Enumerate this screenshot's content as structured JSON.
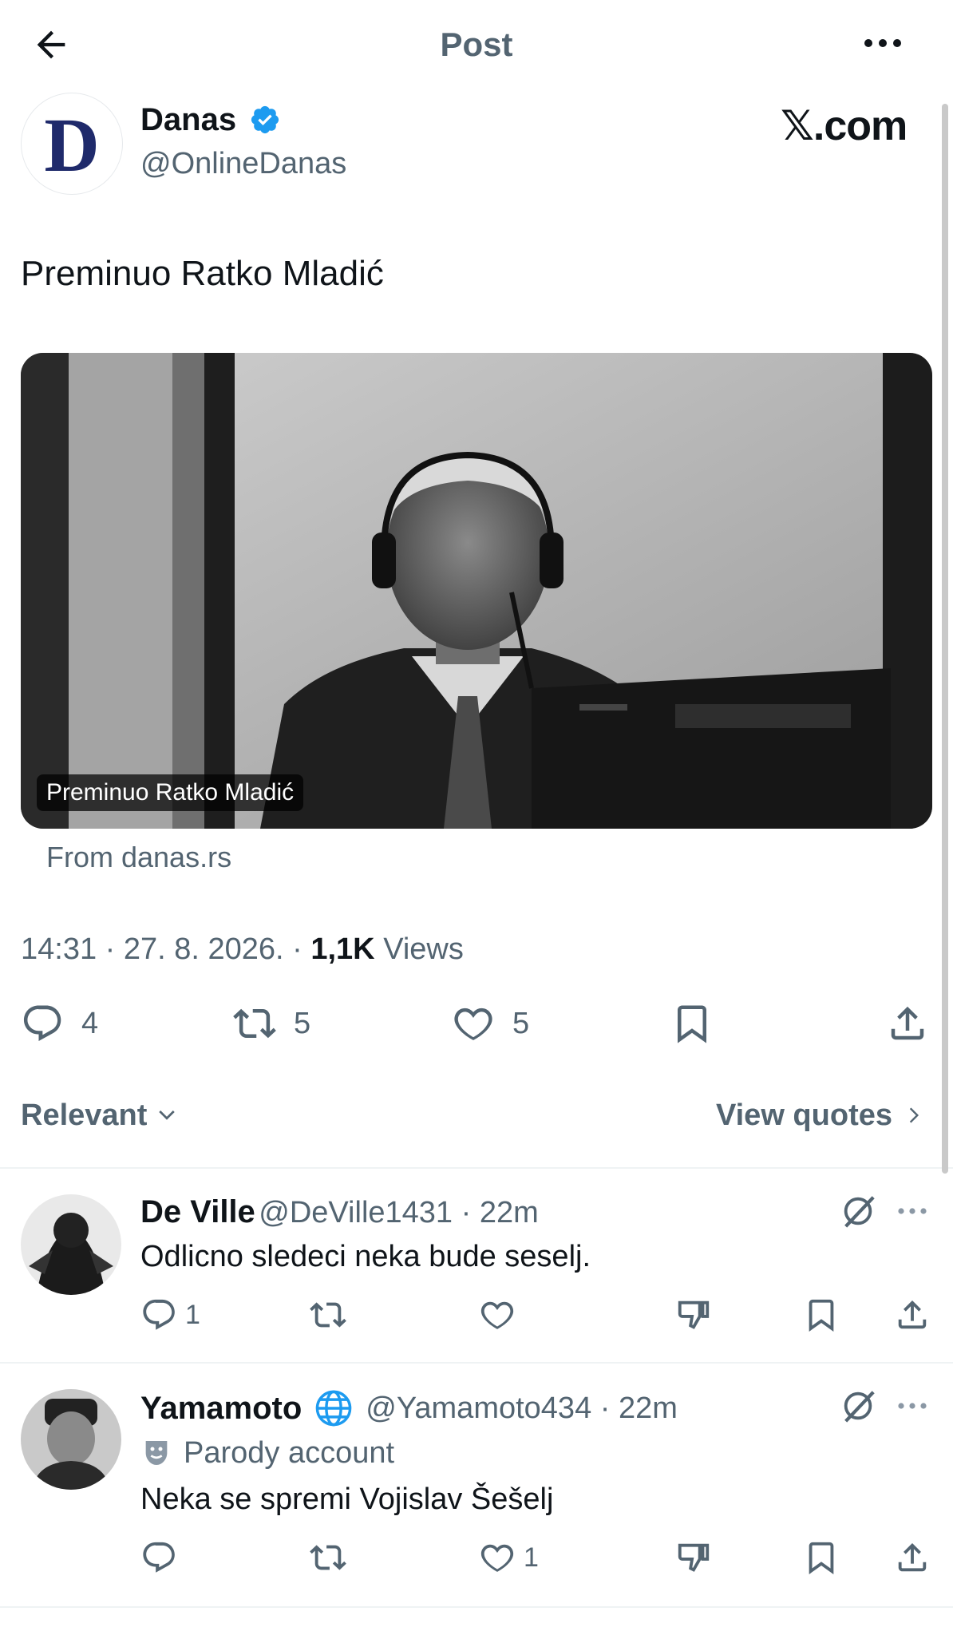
{
  "header": {
    "title": "Post"
  },
  "author": {
    "name": "Danas",
    "handle": "@OnlineDanas",
    "avatar_letter": "D",
    "verified": true
  },
  "brand": {
    "text": "𝕏.com"
  },
  "post": {
    "text": "Preminuo Ratko Mladić",
    "media_caption": "Preminuo Ratko Mladić",
    "source": "From danas.rs",
    "time": "14:31 · 27. 8. 2026. · ",
    "views_count": "1,1K",
    "views_label": " Views"
  },
  "actions": {
    "replies": "4",
    "reposts": "5",
    "likes": "5"
  },
  "filters": {
    "sort_label": "Relevant",
    "quotes_label": "View quotes"
  },
  "replies": [
    {
      "name": "De Ville",
      "handle": "@DeVille1431 · 22m",
      "text": "Odlicno sledeci neka bude seselj.",
      "reply_count": "1",
      "like_count": ""
    },
    {
      "name": "Yamamoto",
      "handle": "@Yamamoto434 · 22m",
      "label": "Parody account",
      "text": "Neka se spremi Vojislav Šešelj",
      "reply_count": "",
      "like_count": "1"
    }
  ],
  "colors": {
    "text": "#0f1419",
    "secondary": "#536471",
    "verified": "#1d9bf0",
    "divider": "#eff3f4"
  }
}
